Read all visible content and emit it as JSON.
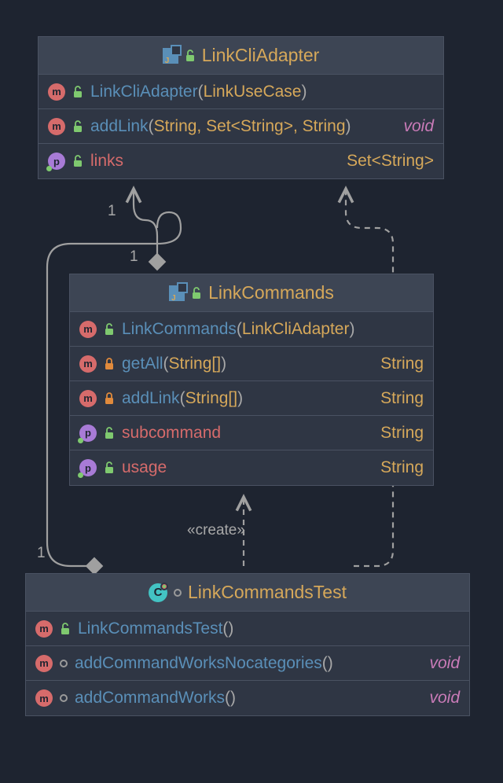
{
  "classes": {
    "linkCliAdapter": {
      "name": "LinkCliAdapter",
      "members": {
        "ctor": {
          "name": "LinkCliAdapter",
          "params": "LinkUseCase"
        },
        "addLink": {
          "name": "addLink",
          "params": "String, Set<String>, String",
          "ret": "void"
        },
        "links": {
          "name": "links",
          "type": "Set<String>"
        }
      }
    },
    "linkCommands": {
      "name": "LinkCommands",
      "members": {
        "ctor": {
          "name": "LinkCommands",
          "params": "LinkCliAdapter"
        },
        "getAll": {
          "name": "getAll",
          "params": "String[]",
          "ret": "String"
        },
        "addLink": {
          "name": "addLink",
          "params": "String[]",
          "ret": "String"
        },
        "subcommand": {
          "name": "subcommand",
          "type": "String"
        },
        "usage": {
          "name": "usage",
          "type": "String"
        }
      }
    },
    "linkCommandsTest": {
      "name": "LinkCommandsTest",
      "members": {
        "ctor": {
          "name": "LinkCommandsTest"
        },
        "m1": {
          "name": "addCommandWorksNocategories",
          "ret": "void"
        },
        "m2": {
          "name": "addCommandWorks",
          "ret": "void"
        }
      }
    }
  },
  "labels": {
    "one_a": "1",
    "one_b": "1",
    "one_c": "1",
    "create": "«create»"
  },
  "badges": {
    "m": "m",
    "p": "p",
    "c": "C"
  }
}
